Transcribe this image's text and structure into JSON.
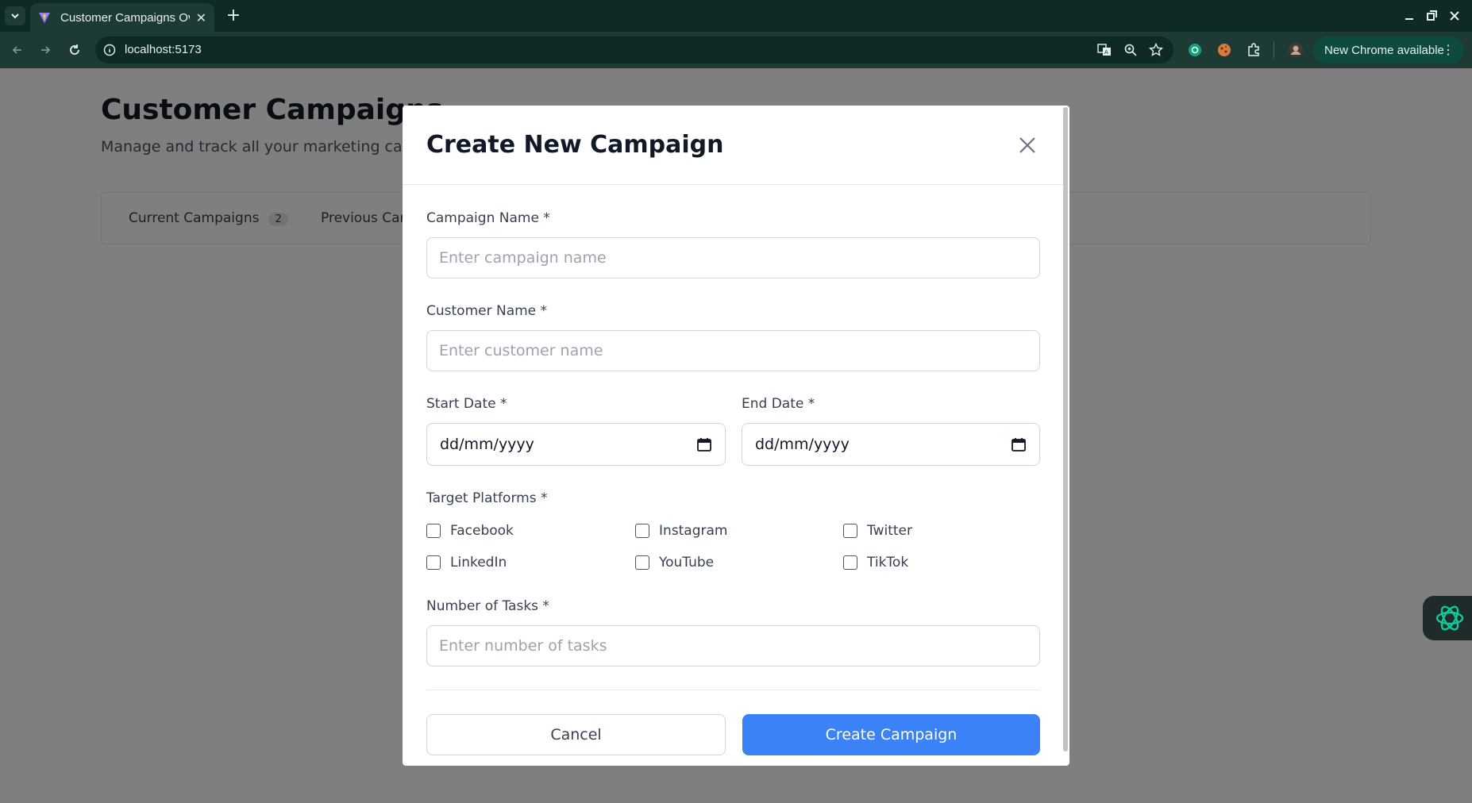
{
  "browser": {
    "tab_title": "Customer Campaigns Ov",
    "url": "localhost:5173",
    "update_label": "New Chrome available"
  },
  "page": {
    "title": "Customer Campaigns",
    "subtitle": "Manage and track all your marketing camp",
    "tabs": [
      {
        "label": "Current Campaigns",
        "count": "2"
      },
      {
        "label": "Previous Cam"
      }
    ]
  },
  "modal": {
    "title": "Create New Campaign",
    "campaign_name": {
      "label": "Campaign Name *",
      "placeholder": "Enter campaign name",
      "value": ""
    },
    "customer_name": {
      "label": "Customer Name *",
      "placeholder": "Enter customer name",
      "value": ""
    },
    "start_date": {
      "label": "Start Date *",
      "value": "dd/mm/yyyy"
    },
    "end_date": {
      "label": "End Date *",
      "value": "dd/mm/yyyy"
    },
    "platforms": {
      "label": "Target Platforms *",
      "options": [
        {
          "label": "Facebook",
          "checked": false
        },
        {
          "label": "Instagram",
          "checked": false
        },
        {
          "label": "Twitter",
          "checked": false
        },
        {
          "label": "LinkedIn",
          "checked": false
        },
        {
          "label": "YouTube",
          "checked": false
        },
        {
          "label": "TikTok",
          "checked": false
        }
      ]
    },
    "tasks": {
      "label": "Number of Tasks *",
      "placeholder": "Enter number of tasks",
      "value": ""
    },
    "cancel_label": "Cancel",
    "create_label": "Create Campaign"
  },
  "colors": {
    "primary": "#3b82f6",
    "chrome_dark": "#0f2a26",
    "chrome_mid": "#1e3a35",
    "overlay": "rgba(0,0,0,0.5)"
  }
}
